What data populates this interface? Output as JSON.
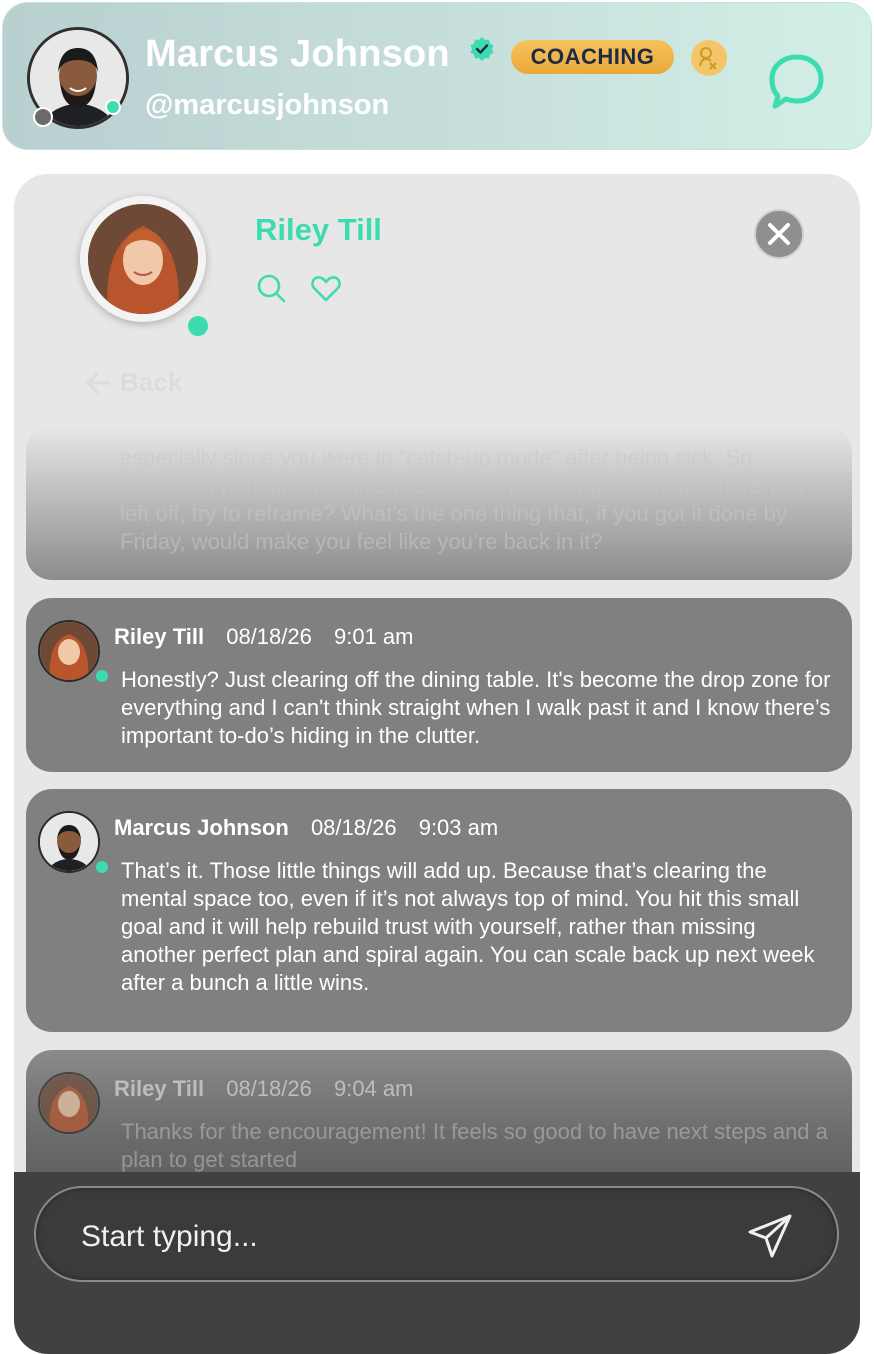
{
  "header": {
    "name": "Marcus Johnson",
    "handle": "@marcusjohnson",
    "badge": "COACHING",
    "icons": [
      "avatar-photo",
      "verified-icon",
      "coach-icon",
      "chat-bubble-icon"
    ]
  },
  "contact": {
    "name": "Riley Till",
    "back_label": "Back",
    "icons": [
      "search-icon",
      "heart-icon",
      "close-icon",
      "arrow-left-icon"
    ]
  },
  "messages": [
    {
      "body": "especially since you were in “catch-up mode” after being sick. So instead of putting on all this pressure to pick things back up where you left off, try to reframe? What’s the one thing that, if you got it done by Friday, would make you feel like you’re back in it?"
    },
    {
      "author": "Riley Till",
      "date": "08/18/26",
      "time": "9:01 am",
      "body": "Honestly? Just clearing off the dining table. It's become the drop zone for everything and I can't think straight when I walk past it and I know there’s important to-do’s hiding in the clutter."
    },
    {
      "author": "Marcus Johnson",
      "date": "08/18/26",
      "time": "9:03 am",
      "body": "That’s it. Those little things will add up. Because that’s clearing the mental space too, even if it’s not always top of mind. You hit this small goal and it will help rebuild trust with yourself, rather than missing another perfect plan and spiral again. You can scale back up next week after a bunch a little wins."
    },
    {
      "author": "Riley Till",
      "date": "08/18/26",
      "time": "9:04 am",
      "body": "Thanks for the encouragement! It feels so good to have next steps and a plan to get started"
    }
  ],
  "composer": {
    "placeholder": "Start typing...",
    "send_icon": "send-icon"
  },
  "colors": {
    "accent": "#3ddbb0",
    "badge": "#f0b448",
    "bubble": "#808080"
  }
}
